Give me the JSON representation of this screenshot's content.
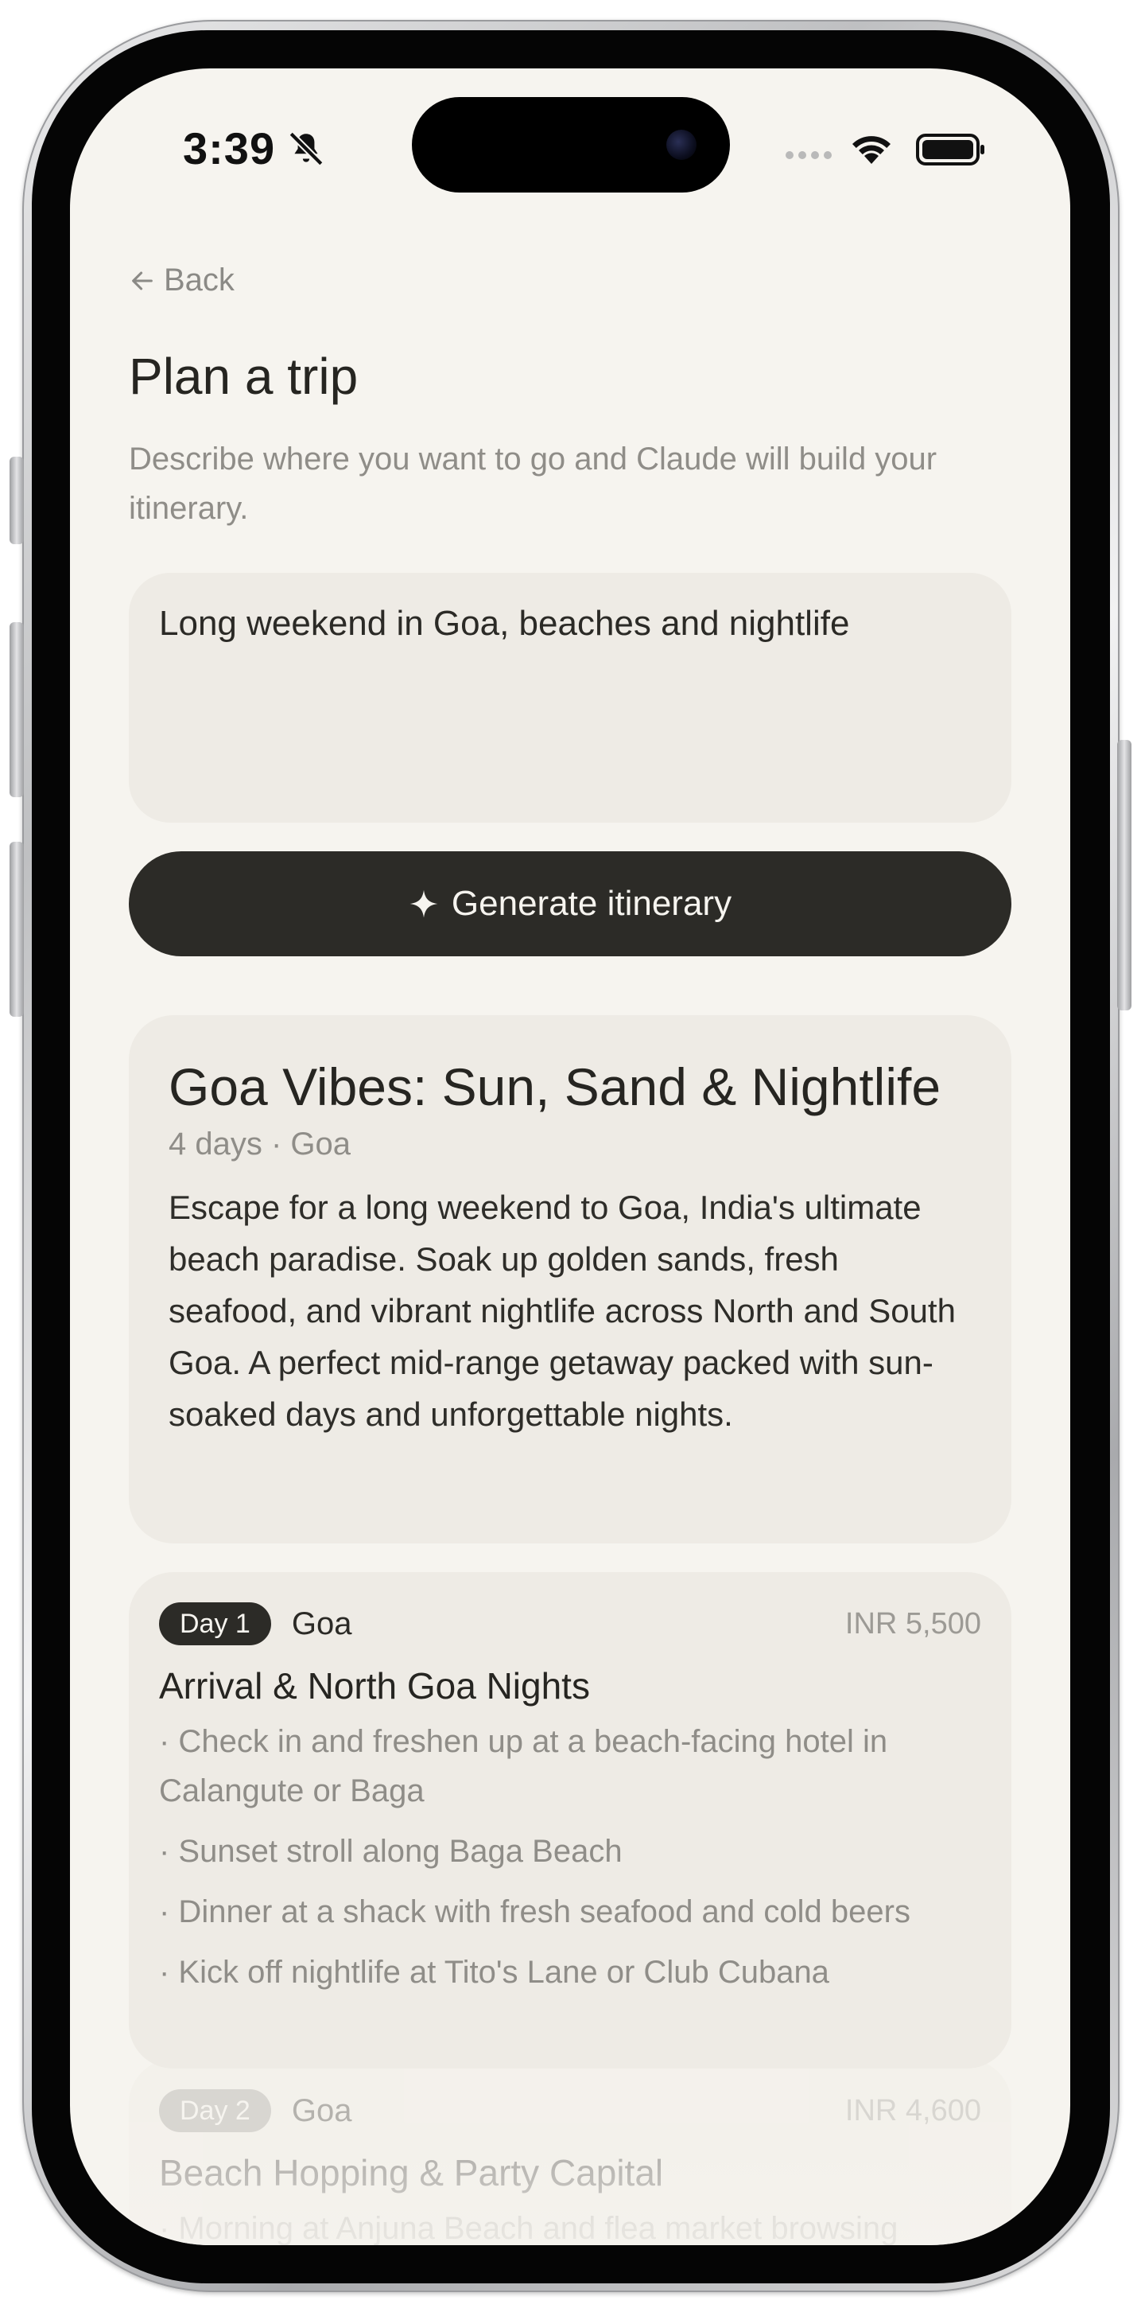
{
  "status_bar": {
    "time": "3:39",
    "icons": [
      "bell-off-icon",
      "signal-dots-icon",
      "wifi-icon",
      "battery-icon"
    ]
  },
  "nav": {
    "back_label": "Back",
    "back_icon": "arrow-left-icon"
  },
  "header": {
    "title": "Plan a trip",
    "subtitle": "Describe where you want to go and Claude will build your itinerary."
  },
  "prompt": {
    "value": "Long weekend in Goa, beaches and nightlife"
  },
  "generate": {
    "label": "Generate itinerary",
    "icon": "sparkle-icon"
  },
  "summary": {
    "title": "Goa Vibes: Sun, Sand & Nightlife",
    "meta": "4 days · Goa",
    "description": "Escape for a long weekend to Goa, India's ultimate beach paradise. Soak up golden sands, fresh seafood, and vibrant nightlife across North and South Goa. A perfect mid-range getaway packed with sun-soaked days and unforgettable nights."
  },
  "days": [
    {
      "badge": "Day 1",
      "location": "Goa",
      "cost": "INR 5,500",
      "title": "Arrival & North Goa Nights",
      "activities": [
        "· Check in and freshen up at a beach-facing hotel in Calangute or Baga",
        "· Sunset stroll along Baga Beach",
        "· Dinner at a shack with fresh seafood and cold beers",
        "· Kick off nightlife at Tito's Lane or Club Cubana"
      ]
    },
    {
      "badge": "Day 2",
      "location": "Goa",
      "cost": "INR 4,600",
      "title": "Beach Hopping & Party Capital",
      "activities": [
        "· Morning at Anjuna Beach and flea market browsing"
      ]
    }
  ],
  "colors": {
    "screen_bg": "#f6f4ef",
    "card_bg": "#eeebe5",
    "primary_dark": "#2c2b27",
    "muted_text": "#8f8d88"
  }
}
